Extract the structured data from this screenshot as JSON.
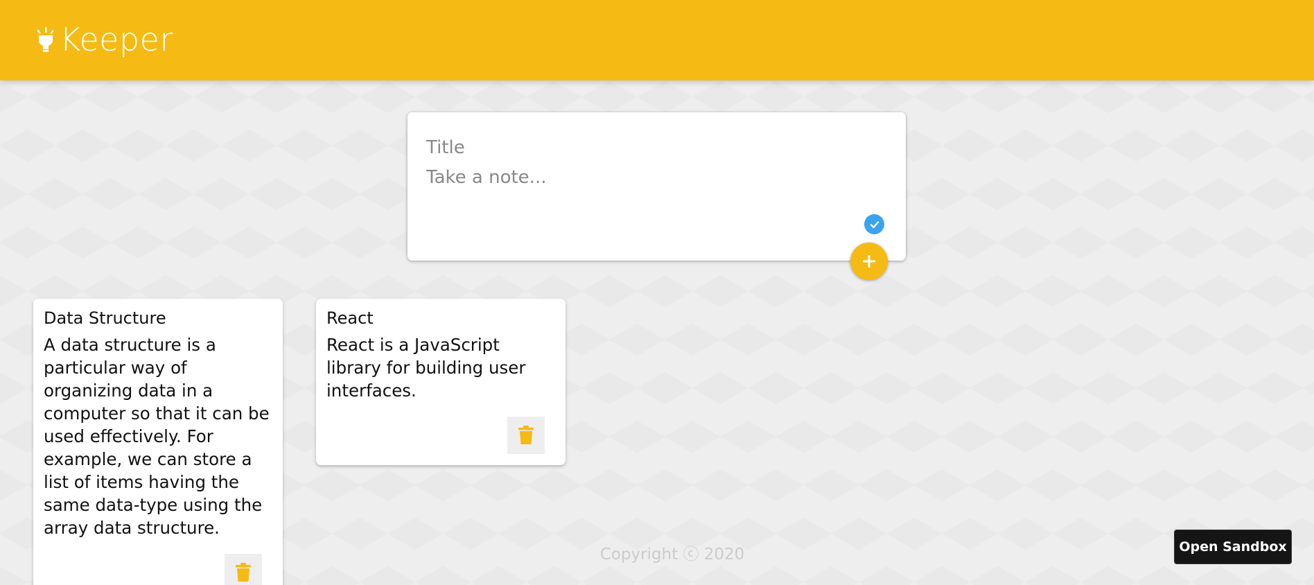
{
  "header": {
    "app_name": "Keeper",
    "brand_color": "#f5ba13",
    "logo_icon": "lightbulb-icon"
  },
  "create_note": {
    "title_placeholder": "Title",
    "content_placeholder": "Take a note...",
    "title_value": "",
    "content_value": "",
    "status_icon": "check-circle-icon",
    "add_icon": "plus-icon"
  },
  "notes": [
    {
      "title": "Data Structure",
      "content": "A data structure is a particular way of organizing data in a computer so that it can be used effectively. For example, we can store a list of items having the same data-type using the array data structure.",
      "delete_icon": "trash-icon"
    },
    {
      "title": "React",
      "content": "React is a JavaScript library for building user interfaces.",
      "delete_icon": "trash-icon"
    }
  ],
  "footer": {
    "copyright": "Copyright ⓒ 2020"
  },
  "sandbox_button": {
    "label": "Open Sandbox"
  },
  "colors": {
    "accent": "#f5ba13",
    "check_blue": "#3ba3f0",
    "background": "#eeeeee"
  }
}
